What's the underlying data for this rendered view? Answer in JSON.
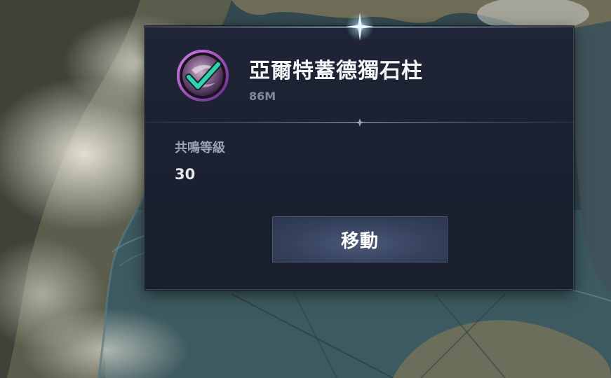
{
  "popup": {
    "title": "亞爾特蓋德獨石柱",
    "distance": "86M",
    "stat_label": "共鳴等級",
    "stat_value": "30",
    "move_button_label": "移動",
    "icon": "checkmark-badge-icon"
  },
  "colors": {
    "check_green": "#2fd3b0",
    "badge_purple": "#8a3fa8",
    "panel_bg": "#1c2131",
    "button_bg": "#3a4662"
  }
}
